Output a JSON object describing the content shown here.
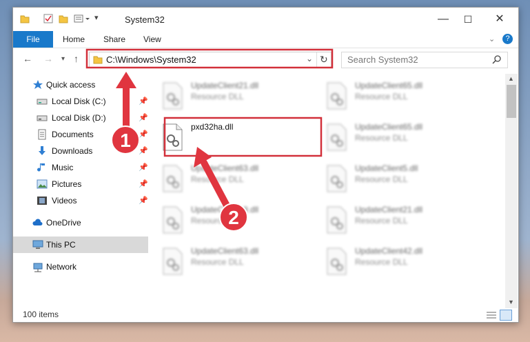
{
  "window": {
    "title": "System32",
    "controls": {
      "minimize": "—",
      "maximize": "☐",
      "close": "✕"
    }
  },
  "ribbon": {
    "tabs": [
      {
        "label": "File",
        "active": true
      },
      {
        "label": "Home"
      },
      {
        "label": "Share"
      },
      {
        "label": "View"
      }
    ],
    "help": "?"
  },
  "navigation": {
    "address": "C:\\Windows\\System32",
    "search_placeholder": "Search System32"
  },
  "sidebar": {
    "items": [
      {
        "label": "Quick access",
        "icon": "star-icon"
      },
      {
        "label": "Local Disk (C:)",
        "icon": "drive-icon",
        "pinned": true
      },
      {
        "label": "Local Disk (D:)",
        "icon": "drive-icon",
        "pinned": true
      },
      {
        "label": "Documents",
        "icon": "documents-icon",
        "pinned": true
      },
      {
        "label": "Downloads",
        "icon": "download-icon",
        "pinned": true
      },
      {
        "label": "Music",
        "icon": "music-icon",
        "pinned": true
      },
      {
        "label": "Pictures",
        "icon": "pictures-icon",
        "pinned": true
      },
      {
        "label": "Videos",
        "icon": "videos-icon",
        "pinned": true
      },
      {
        "label": "OneDrive",
        "icon": "cloud-icon"
      },
      {
        "label": "This PC",
        "icon": "computer-icon",
        "selected": true
      },
      {
        "label": "Network",
        "icon": "network-icon"
      }
    ]
  },
  "files": [
    {
      "name": "UpdateClient21.dll",
      "type": "Resource DLL",
      "blurred": true
    },
    {
      "name": "UpdateClient65.dll",
      "type": "Resource DLL",
      "blurred": true
    },
    {
      "name": "pxd32ha.dll",
      "type": "",
      "blurred": false
    },
    {
      "name": "UpdateClient65.dll",
      "type": "Resource DLL",
      "blurred": true
    },
    {
      "name": "UpdateClient63.dll",
      "type": "Resource DLL",
      "blurred": true
    },
    {
      "name": "UpdateClient5.dll",
      "type": "Resource DLL",
      "blurred": true
    },
    {
      "name": "UpdateClient19.dll",
      "type": "Resource DLL",
      "blurred": true
    },
    {
      "name": "UpdateClient21.dll",
      "type": "Resource DLL",
      "blurred": true
    },
    {
      "name": "UpdateClient63.dll",
      "type": "Resource DLL",
      "blurred": true
    },
    {
      "name": "UpdateClient42.dll",
      "type": "Resource DLL",
      "blurred": true
    }
  ],
  "status": {
    "item_count": "100 items"
  },
  "annotations": {
    "step1": "1",
    "step2": "2",
    "color": "#e0353f"
  }
}
